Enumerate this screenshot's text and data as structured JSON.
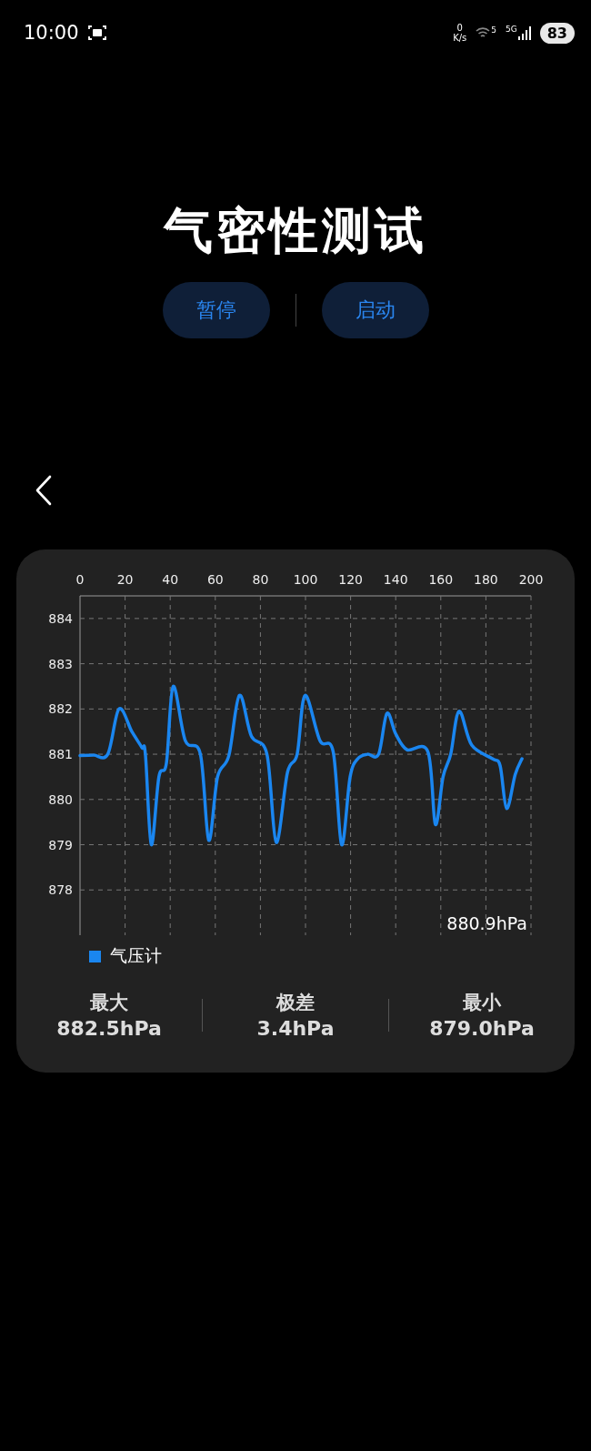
{
  "status_bar": {
    "time": "10:00",
    "net_speed_value": "0",
    "net_speed_unit": "K/s",
    "wifi_badge": "5",
    "signal_badge": "5G",
    "battery": "83"
  },
  "title": "气密性测试",
  "buttons": [
    {
      "label": "暂停"
    },
    {
      "label": "启动"
    }
  ],
  "chart_card": {
    "chart_data": {
      "type": "line",
      "x": [
        0,
        6,
        12.3,
        17.3,
        23,
        27.4,
        29,
        31.6,
        35,
        38.3,
        41.3,
        46.7,
        53.4,
        57.1,
        61,
        66,
        70.7,
        76,
        82.9,
        87,
        92,
        96.3,
        99.8,
        106.4,
        112.3,
        116,
        119.8,
        123.2,
        127.4,
        132.4,
        136.1,
        140,
        145,
        154.3,
        157.6,
        161,
        164.4,
        168.1,
        173.7,
        182.9,
        186.3,
        189.2,
        193,
        196
      ],
      "series": [
        {
          "name": "气压计",
          "color": "#1a86f0",
          "values": [
            880.97,
            880.98,
            881.0,
            882.0,
            881.5,
            881.15,
            881.0,
            879.0,
            880.5,
            880.8,
            882.5,
            881.3,
            881.0,
            879.1,
            880.5,
            880.97,
            882.3,
            881.4,
            881.0,
            879.05,
            880.6,
            881.0,
            882.3,
            881.3,
            881.05,
            879.0,
            880.5,
            880.9,
            881.0,
            881.0,
            881.9,
            881.45,
            881.1,
            881.05,
            879.45,
            880.5,
            881.0,
            881.95,
            881.2,
            880.9,
            880.75,
            879.8,
            880.55,
            880.9
          ]
        }
      ],
      "xlim": [
        0,
        200
      ],
      "ylim": [
        877,
        884.5
      ],
      "xticks": [
        0,
        20,
        40,
        60,
        80,
        100,
        120,
        140,
        160,
        180,
        200
      ],
      "yticks": [
        878,
        879,
        880,
        881,
        882,
        883,
        884
      ],
      "grid": true
    },
    "current_reading": "880.9hPa",
    "stats": [
      {
        "label": "最大",
        "value": "882.5hPa"
      },
      {
        "label": "极差",
        "value": "3.4hPa"
      },
      {
        "label": "最小",
        "value": "879.0hPa"
      }
    ]
  }
}
